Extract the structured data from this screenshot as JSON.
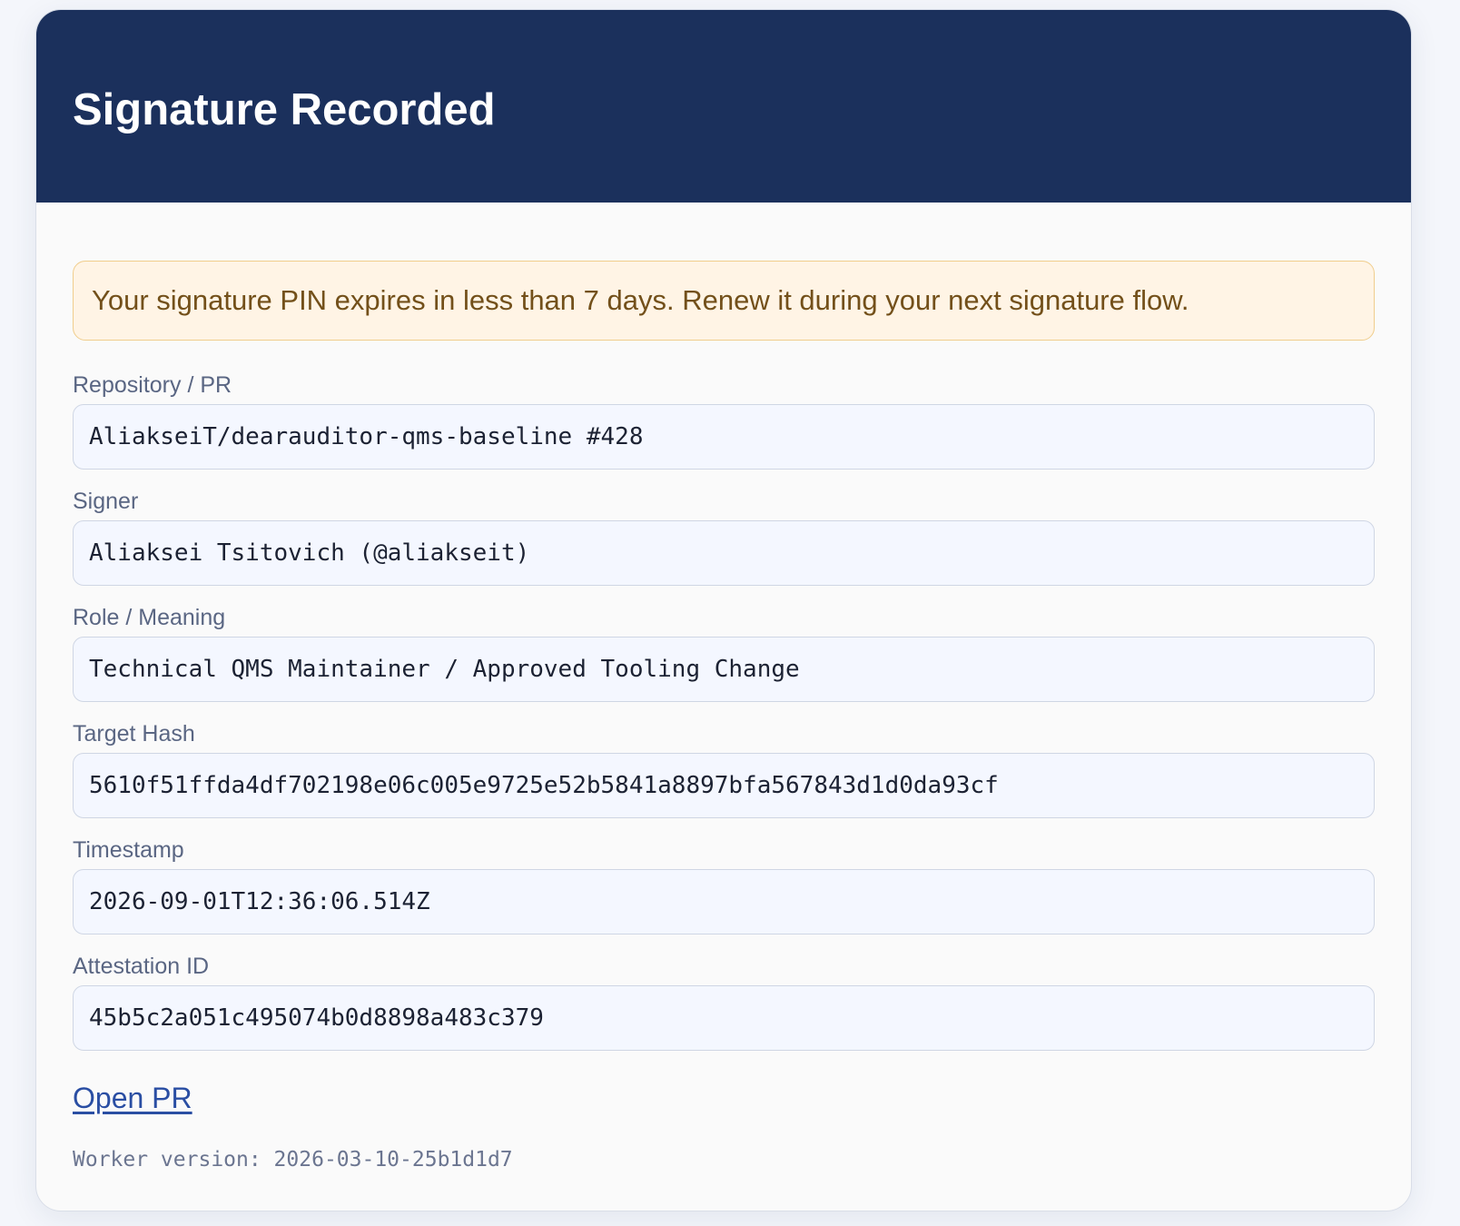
{
  "header": {
    "title": "Signature Recorded"
  },
  "notice": {
    "text": "Your signature PIN expires in less than 7 days. Renew it during your next signature flow."
  },
  "fields": [
    {
      "label": "Repository / PR",
      "value": "AliakseiT/dearauditor-qms-baseline #428"
    },
    {
      "label": "Signer",
      "value": "Aliaksei Tsitovich (@aliakseit)"
    },
    {
      "label": "Role / Meaning",
      "value": "Technical QMS Maintainer / Approved Tooling Change"
    },
    {
      "label": "Target Hash",
      "value": "5610f51ffda4df702198e06c005e9725e52b5841a8897bfa567843d1d0da93cf"
    },
    {
      "label": "Timestamp",
      "value": "2026-09-01T12:36:06.514Z"
    },
    {
      "label": "Attestation ID",
      "value": "45b5c2a051c495074b0d8898a483c379"
    }
  ],
  "link": {
    "label": "Open PR"
  },
  "footer": {
    "worker_version": "Worker version: 2026-03-10-25b1d1d7"
  },
  "colors": {
    "header_bg": "#1b305c",
    "notice_bg": "#fff4e5",
    "notice_text": "#73501a",
    "link": "#2a4ea3"
  }
}
